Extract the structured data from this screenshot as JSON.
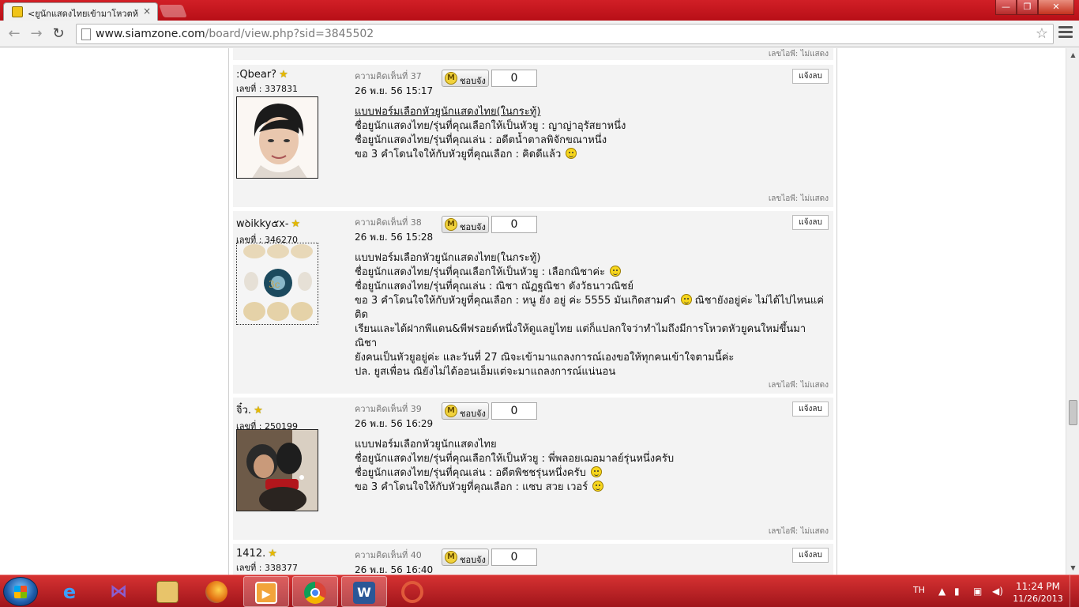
{
  "browser": {
    "tab_title": "<ยูนักแสดงไทยเข้ามาโหวตห้",
    "tab_close": "×",
    "url_host": "www.siamzone.com",
    "url_path": "/board/view.php?sid=3845502",
    "window_buttons": {
      "minimize": "—",
      "maximize": "❐",
      "close": "✕"
    },
    "nav": {
      "back": "←",
      "forward": "→",
      "reload": "↻",
      "star": "☆"
    }
  },
  "top_ip_label": "เลขไอพี: ไม่แสดง",
  "thanks_label": "ชอบจัง",
  "report_label": "แจ้งลบ",
  "posts": [
    {
      "username": ":Qbear?",
      "member_no": "เลขที่ : 337831",
      "comment_no": "ความคิดเห็นที่ 37",
      "date": "26 พ.ย. 56 15:17",
      "count": "0",
      "lines": [
        "แบบฟอร์มเลือกหัวยูนักแสดงไทย(ในกระทู้)",
        "ชื่อยูนักแสดงไทย/รุ่นที่คุณเลือกให้เป็นหัวยู : ญาญ่าอุรัสยาหนึ่ง",
        "ชื่อยูนักแสดงไทย/รุ่นที่คุณเล่น : อดีตน้ำตาลพิจักขณาหนึ่ง",
        "ขอ 3 คำโดนใจให้กับหัวยูที่คุณเลือก : คิดดีแล้ว"
      ],
      "ip": "เลขไอพี: ไม่แสดง"
    },
    {
      "username": "wꝺikky๕x-",
      "member_no": "เลขที่ : 346270",
      "comment_no": "ความคิดเห็นที่ 38",
      "date": "26 พ.ย. 56 15:28",
      "count": "0",
      "lines": [
        "แบบฟอร์มเลือกหัวยูนักแสดงไทย(ในกระทู้)",
        "ชื่อยูนักแสดงไทย/รุ่นที่คุณเลือกให้เป็นหัวยู : เลือกณิชาค่ะ",
        "ชื่อยูนักแสดงไทย/รุ่นที่คุณเล่น : ณิชา ณัฏฐณิชา ดังวัธนาวณิชย์",
        "ขอ 3 คำโดนใจให้กับหัวยูที่คุณเลือก : หนู ยัง อยู่ ค่ะ 5555 มันเกิดสามคำ",
        "ณิชายังอยู่ค่ะ ไม่ได้ไปไหนแค่ติด",
        "เรียนและได้ฝากพีแดน&พีฟรอยด์หนึ่งให้ดูแลยูไทย แต่ก็แปลกใจว่าทำไมถึงมีการโหวตหัวยูคนใหม่ขึ้นมา ณิชา",
        "ยังคนเป็นหัวยูอยู่ค่ะ และวันที่ 27 ณิจะเข้ามาแถลงการณ์เองขอให้ทุกคนเข้าใจตามนี้ค่ะ",
        "ปล. ยูสเพื่อน ณิยังไม่ได้ออนเอ็มแต่จะมาแถลงการณ์แน่นอน"
      ],
      "ip": "เลขไอพี: ไม่แสดง"
    },
    {
      "username": "จิ๋ว.",
      "member_no": "เลขที่ : 250199",
      "comment_no": "ความคิดเห็นที่ 39",
      "date": "26 พ.ย. 56 16:29",
      "count": "0",
      "lines": [
        "แบบฟอร์มเลือกหัวยูนักแสดงไทย",
        "ชื่อยูนักแสดงไทย/รุ่นที่คุณเลือกให้เป็นหัวยู : พี่พลอยเฌอมาลย์รุ่นหนึ่งครับ",
        "ชื่อยูนักแสดงไทย/รุ่นที่คุณเล่น : อดีตพิชชรุ่นหนึ่งครับ",
        "ขอ 3 คำโดนใจให้กับหัวยูที่คุณเลือก : แซบ สวย เวอร์"
      ],
      "ip": "เลขไอพี: ไม่แสดง"
    },
    {
      "username": "1412.",
      "member_no": "เลขที่ : 338377",
      "comment_no": "ความคิดเห็นที่ 40",
      "date": "26 พ.ย. 56 16:40",
      "count": "0"
    }
  ],
  "taskbar": {
    "lang": "TH",
    "time": "11:24 PM",
    "date": "11/26/2013",
    "apps": [
      "internet-explorer",
      "visual-studio",
      "file-explorer",
      "firefox",
      "media-player",
      "chrome",
      "word",
      "unknown-app"
    ]
  }
}
